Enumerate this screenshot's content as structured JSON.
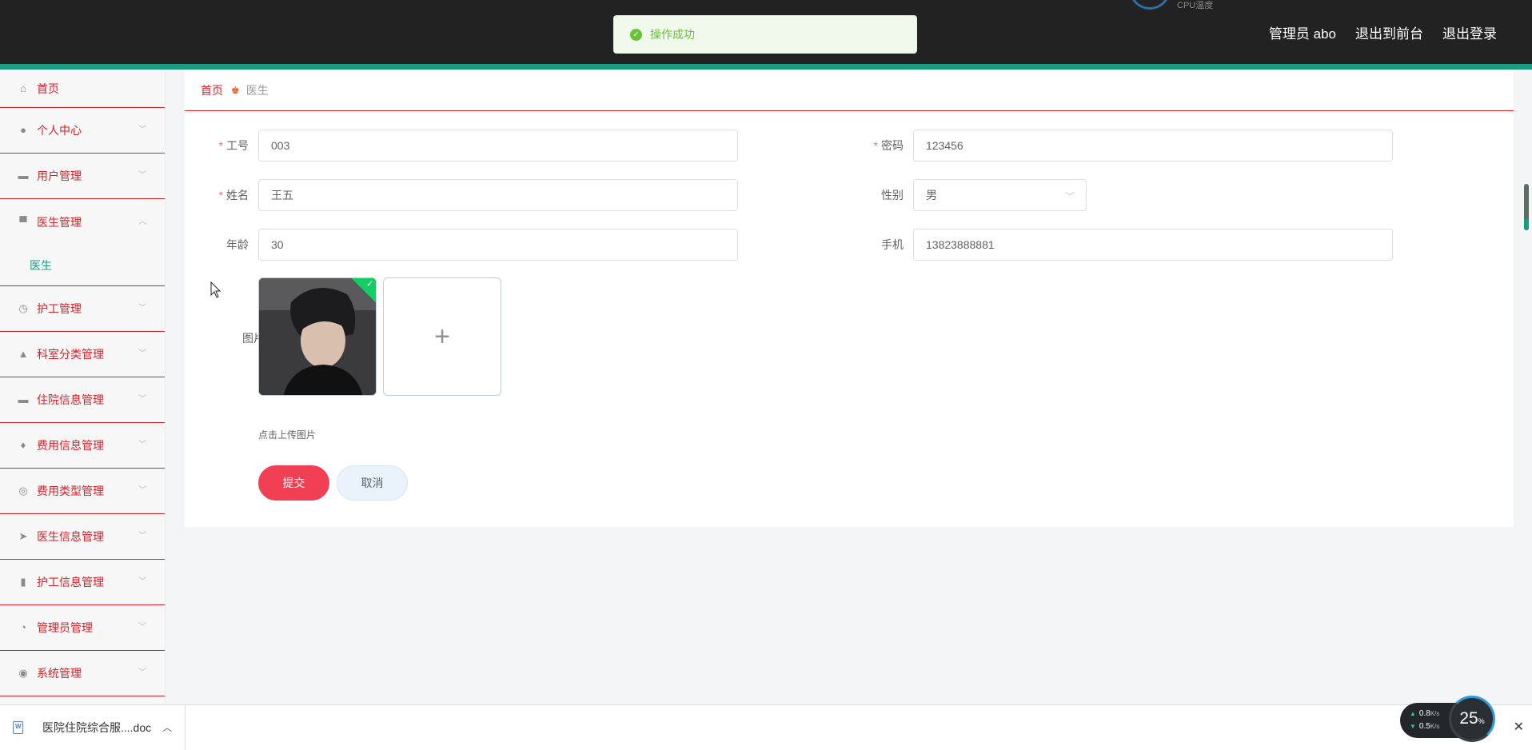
{
  "header": {
    "cpu_label": "CPU温度",
    "links": [
      "管理员 abo",
      "退出到前台",
      "退出登录"
    ]
  },
  "toast": {
    "text": "操作成功"
  },
  "sidebar": {
    "items": [
      {
        "label": "首页",
        "icon": "home-icon"
      },
      {
        "label": "个人中心",
        "icon": "user-icon"
      },
      {
        "label": "用户管理",
        "icon": "ticket-icon"
      },
      {
        "label": "医生管理",
        "icon": "monitor-icon",
        "open": true,
        "children": [
          "医生"
        ]
      },
      {
        "label": "护工管理",
        "icon": "gauge-icon"
      },
      {
        "label": "科室分类管理",
        "icon": "person-icon"
      },
      {
        "label": "住院信息管理",
        "icon": "chat-icon"
      },
      {
        "label": "费用信息管理",
        "icon": "microphone-icon"
      },
      {
        "label": "费用类型管理",
        "icon": "dial-icon"
      },
      {
        "label": "医生信息管理",
        "icon": "send-icon"
      },
      {
        "label": "护工信息管理",
        "icon": "bar-chart-icon"
      },
      {
        "label": "管理员管理",
        "icon": "clock-icon"
      },
      {
        "label": "系统管理",
        "icon": "lifebuoy-icon"
      }
    ]
  },
  "breadcrumb": {
    "home": "首页",
    "current": "医生"
  },
  "form": {
    "job_no": {
      "label": "工号",
      "value": "003",
      "required": true
    },
    "password": {
      "label": "密码",
      "value": "123456",
      "required": true
    },
    "name": {
      "label": "姓名",
      "value": "王五",
      "required": true
    },
    "gender": {
      "label": "性别",
      "value": "男"
    },
    "age": {
      "label": "年龄",
      "value": "30"
    },
    "phone": {
      "label": "手机",
      "value": "13823888881"
    },
    "image": {
      "label": "图片",
      "tip": "点击上传图片"
    },
    "submit": "提交",
    "cancel": "取消"
  },
  "download_bar": {
    "file_name": "医院住院综合服....doc",
    "upload_speed": "0.8",
    "download_speed": "0.5",
    "speed_unit": "K/s",
    "cpu_percent": "25",
    "cpu_unit": "%"
  },
  "colors": {
    "header": "#222222",
    "accent_teal": "#1a9b80",
    "menu_red": "#d5222b",
    "submit": "#f13f54",
    "success": "#67c23a"
  }
}
